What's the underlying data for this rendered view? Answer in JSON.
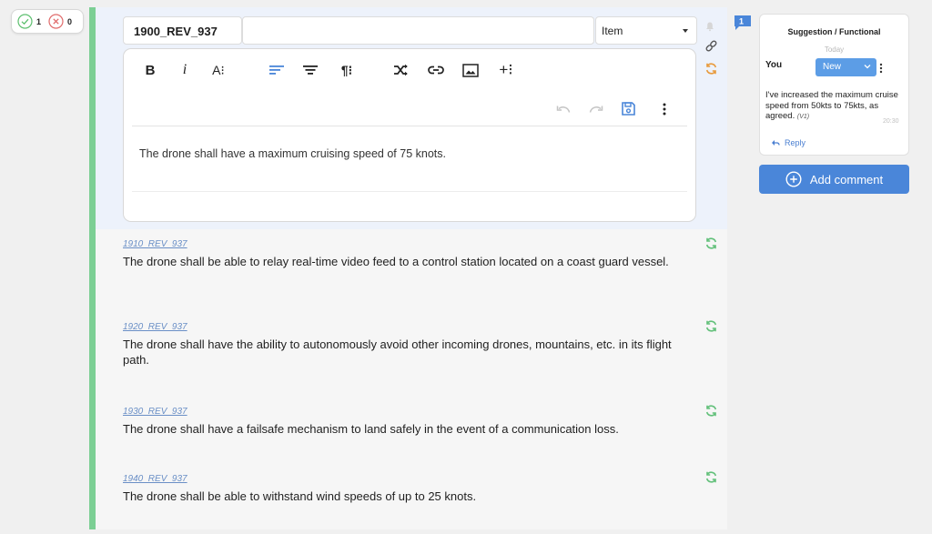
{
  "approval": {
    "approved_count": "1",
    "rejected_count": "0",
    "approved_color": "#5cbf6e",
    "rejected_color": "#e06a6a"
  },
  "active_requirement": {
    "id": "1900_REV_937",
    "type_value": "Item",
    "text": "The drone shall have a maximum cruising speed of 75 knots."
  },
  "editor_toolbar": {
    "bold": "B",
    "italic": "i",
    "font_size": "A⁝",
    "align_left_icon": "align-left-icon",
    "align_center_icon": "align-center-icon",
    "paragraph": "¶⁝",
    "shuffle_icon": "shuffle-icon",
    "link_icon": "link-icon",
    "image_icon": "image-icon",
    "insert": "+⁝",
    "undo_icon": "undo-icon",
    "redo_icon": "redo-icon",
    "save_icon": "save-icon",
    "more_icon": "more-vertical-icon"
  },
  "requirements": [
    {
      "id": "1910_REV_937",
      "text": "The drone shall be able to relay real-time video feed to a control station located on a coast guard vessel."
    },
    {
      "id": "1920_REV_937",
      "text": "The drone shall have the ability to autonomously avoid other incoming drones, mountains, etc. in its flight path."
    },
    {
      "id": "1930_REV_937",
      "text": "The drone shall have a failsafe mechanism to land safely in the event of a communication loss."
    },
    {
      "id": "1940_REV_937",
      "text": "The drone shall be able to withstand wind speeds of up to 25 knots."
    }
  ],
  "comments": {
    "badge_count": "1",
    "card": {
      "title": "Suggestion / Functional",
      "day": "Today",
      "author": "You",
      "status": "New",
      "body": "I've increased the maximum cruise speed from 50kts to 75kts, as agreed.",
      "version": "(V1)",
      "time": "20:30",
      "reply_label": "Reply"
    },
    "add_comment_label": "Add comment"
  },
  "colors": {
    "accent": "#4a86d9",
    "status_blue": "#5c9de6",
    "sync_green": "#62c07a",
    "sync_orange": "#e89a3c",
    "left_bar": "#7ccf94"
  }
}
